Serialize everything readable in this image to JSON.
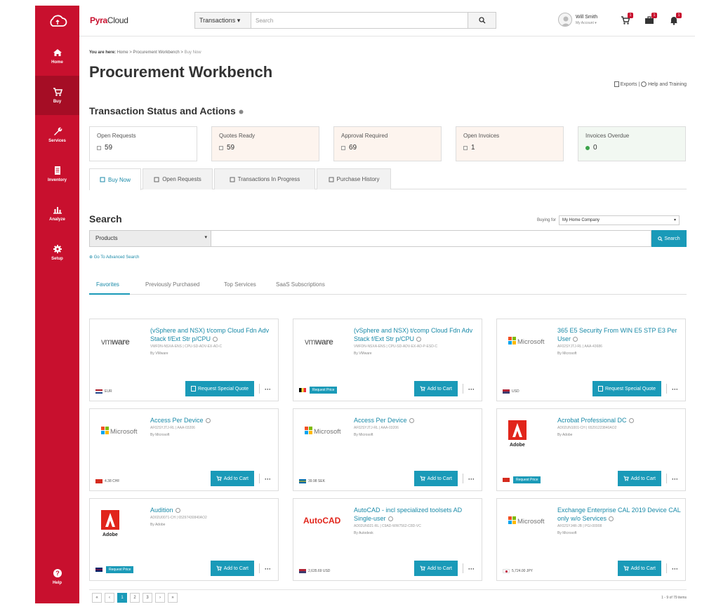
{
  "sidebar": {
    "items": [
      {
        "label": "Home",
        "icon": "home-icon"
      },
      {
        "label": "Buy",
        "icon": "cart-icon",
        "active": true
      },
      {
        "label": "Services",
        "icon": "wrench-icon"
      },
      {
        "label": "Inventory",
        "icon": "document-icon"
      },
      {
        "label": "Analyze",
        "icon": "bar-chart-icon"
      },
      {
        "label": "Setup",
        "icon": "gear-icon"
      }
    ],
    "help": "Help"
  },
  "header": {
    "brand_a": "Pyra",
    "brand_b": "Cloud",
    "search_category": "Transactions",
    "search_placeholder": "Search",
    "user_name": "Will Smith",
    "user_sub": "My Account",
    "badges": [
      "1",
      "1",
      "1"
    ]
  },
  "breadcrumb": {
    "you_are_here": "You are here:",
    "home": "Home",
    "sep": ">",
    "workbench": "Procurement Workbench",
    "current": "Buy Now"
  },
  "page": {
    "title": "Procurement Workbench",
    "exports": "Exports",
    "help_training": "Help and Training",
    "status_title": "Transaction Status and Actions"
  },
  "status_cards": [
    {
      "label": "Open Requests",
      "value": "59",
      "bg": "#ffffff"
    },
    {
      "label": "Quotes Ready",
      "value": "59",
      "bg": "#fdf4ee"
    },
    {
      "label": "Approval Required",
      "value": "69",
      "bg": "#fdf4ee"
    },
    {
      "label": "Open Invoices",
      "value": "1",
      "bg": "#fdf4ee"
    },
    {
      "label": "Invoices Overdue",
      "value": "0",
      "bg": "#f2f8f2"
    }
  ],
  "tabs": [
    "Buy Now",
    "Open Requests",
    "Transactions In Progress",
    "Purchase History"
  ],
  "search": {
    "title": "Search",
    "buying_for_label": "Buying for",
    "buying_for_value": "My Home Company",
    "category": "Products",
    "button": "Search",
    "advanced": "Go To Advanced Search"
  },
  "subtabs": [
    "Favorites",
    "Previously Purchased",
    "Top Services",
    "SaaS Subscriptions"
  ],
  "products": [
    {
      "brand": "vmware",
      "title": "(vSphere and NSX) t/comp Cloud Fdn Adv Stack f/Ext Str p/CPU",
      "sku": "VMFDN-NSXA-ENS | CPU-SD-ADV-EX-AD-C",
      "by": "By VMware",
      "price": "EUR",
      "request_price": "",
      "action": "Request Special Quote",
      "flag": "nl"
    },
    {
      "brand": "vmware",
      "title": "(vSphere and NSX) t/comp Cloud Fdn Adv Stack f/Ext Str p/CPU",
      "sku": "VMFDN-NSXA-ENS | CPU-SD-ADV-EX-AD-P-ESD-C",
      "by": "By VMware",
      "price": "",
      "request_price": "Request Price",
      "action": "Add to Cart",
      "flag": "be"
    },
    {
      "brand": "microsoft",
      "title": "365 E5 Security From WIN E5 STP E3 Per User",
      "sku": "AF02SYJTJ-RL | AAA-43686",
      "by": "By Microsoft",
      "price": "USD",
      "request_price": "",
      "action": "Request Special Quote",
      "flag": "us"
    },
    {
      "brand": "microsoft",
      "title": "Access Per Device",
      "sku": "AF02SYJTJ-RL | AAA-03206",
      "by": "By Microsoft",
      "price": "4.38 CHF",
      "request_price": "",
      "action": "Add to Cart",
      "flag": "ch"
    },
    {
      "brand": "microsoft",
      "title": "Access Per Device",
      "sku": "AF02SYJTJ-RL | AAA-03206",
      "by": "By Microsoft",
      "price": "39.98 SEK",
      "request_price": "",
      "action": "Add to Cart",
      "flag": "se"
    },
    {
      "brand": "adobe",
      "title": "Acrobat Professional DC",
      "sku": "AD02UN1001-CH | 65291223840AO2",
      "by": "By Adobe",
      "price": "",
      "request_price": "Request Price",
      "action": "Add to Cart",
      "flag": "ch"
    },
    {
      "brand": "adobe",
      "title": "Audition",
      "sku": "AD02U0071-CH | 65297430840AO2",
      "by": "By Adobe",
      "price": "",
      "request_price": "Request Price",
      "action": "Add to Cart",
      "flag": "gb"
    },
    {
      "brand": "autocad",
      "title": "AutoCAD - incl specialized toolsets AD Single-user",
      "sku": "AD02UN021-RL | C9AD-WW7562-C8D-VC",
      "by": "By Autodesk",
      "price": "2,635.69 USD",
      "request_price": "",
      "action": "Add to Cart",
      "flag": "us"
    },
    {
      "brand": "microsoft",
      "title": "Exchange Enterprise CAL 2019 Device CAL only w/o Services",
      "sku": "AF02SYJ4R-JB | PGI-00908",
      "by": "By Microsoft",
      "price": "5,724.00 JPY",
      "request_price": "",
      "action": "Add to Cart",
      "flag": "jp"
    }
  ],
  "pager": {
    "pages": [
      "«",
      "‹",
      "1",
      "2",
      "3",
      "›",
      "»"
    ],
    "info": "1 - 9 of 79 items"
  }
}
